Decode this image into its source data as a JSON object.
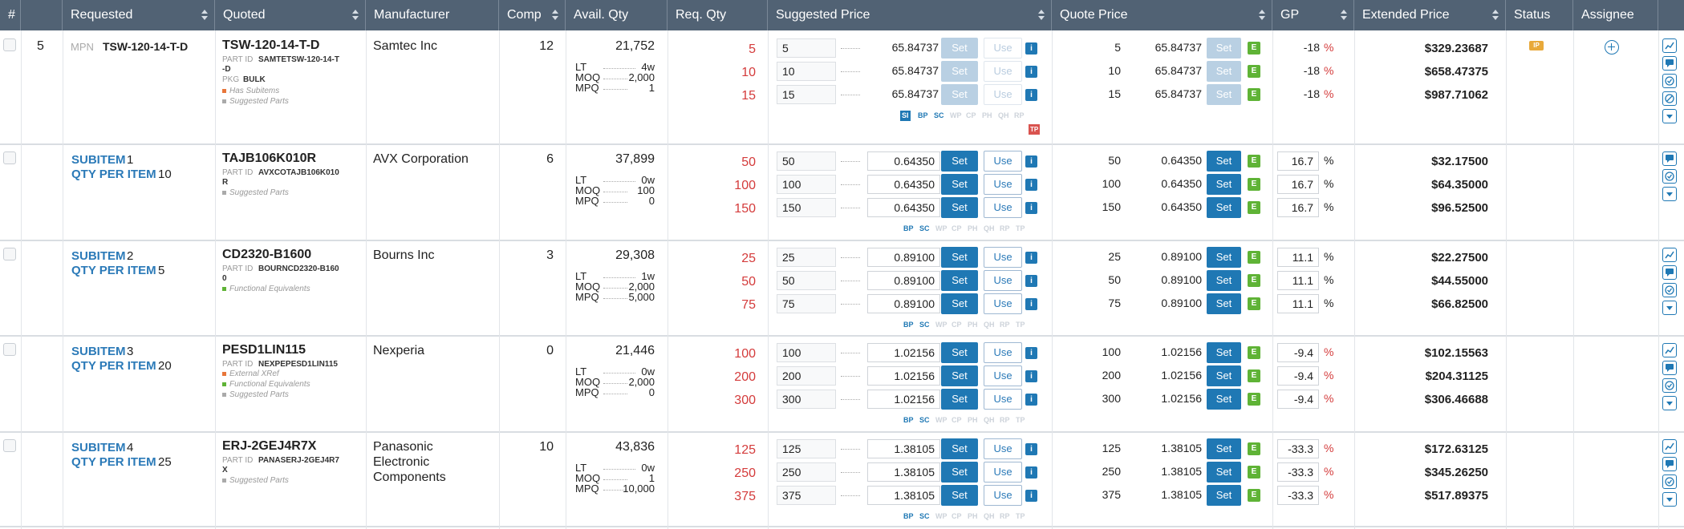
{
  "columns": {
    "num": "#",
    "requested": "Requested",
    "quoted": "Quoted",
    "manufacturer": "Manufacturer",
    "comp": "Comp",
    "avail": "Avail. Qty",
    "req": "Req. Qty",
    "suggested": "Suggested Price",
    "quote": "Quote Price",
    "gp": "GP",
    "extended": "Extended Price",
    "status": "Status",
    "assignee": "Assignee"
  },
  "labels": {
    "mpn": "MPN",
    "part_id": "PART ID",
    "pkg": "PKG",
    "subitem": "SUBITEM",
    "qty_per_item": "QTY PER ITEM",
    "lt": "LT",
    "moq": "MOQ",
    "mpq": "MPQ",
    "set": "Set",
    "use": "Use",
    "info": "i",
    "edit": "E",
    "pct": "%",
    "status_badge": "IP"
  },
  "tags": {
    "si": "SI",
    "bp": "BP",
    "sc": "SC",
    "wp": "WP",
    "cp": "CP",
    "ph": "PH",
    "qh": "QH",
    "rp": "RP",
    "tp": "TP"
  },
  "colors": {
    "header": "#516274",
    "accent": "#1f78b4",
    "edit": "#5fb336",
    "badge": "#e8a93a",
    "alert": "#d43b3b"
  },
  "rows": [
    {
      "row_num": "5",
      "mpn": "TSW-120-14-T-D",
      "quoted": "TSW-120-14-T-D",
      "part_id_l1": "SAMTETSW-120-14-T",
      "part_id_l2": "-D",
      "pkg": "BULK",
      "notes": [
        "Has Subitems",
        "Suggested Parts"
      ],
      "manufacturer": [
        "Samtec Inc"
      ],
      "comp": "12",
      "avail": "21,752",
      "lt": "4w",
      "moq": "2,000",
      "mpq": "1",
      "qtys": [
        "5",
        "10",
        "15"
      ],
      "prices": [
        "65.84737",
        "65.84737",
        "65.84737"
      ],
      "gp": [
        "-18",
        "-18",
        "-18"
      ],
      "ext": [
        "$329.23687",
        "$658.47375",
        "$987.71062"
      ]
    },
    {
      "subitem": "1",
      "qty_per_item": "10",
      "quoted": "TAJB106K010R",
      "part_id_l1": "AVXCOTAJB106K010",
      "part_id_l2": "R",
      "notes": [
        "Suggested Parts"
      ],
      "manufacturer": [
        "AVX Corporation"
      ],
      "comp": "6",
      "avail": "37,899",
      "lt": "0w",
      "moq": "100",
      "mpq": "0",
      "qtys": [
        "50",
        "100",
        "150"
      ],
      "prices": [
        "0.64350",
        "0.64350",
        "0.64350"
      ],
      "gp": [
        "16.7",
        "16.7",
        "16.7"
      ],
      "ext": [
        "$32.17500",
        "$64.35000",
        "$96.52500"
      ]
    },
    {
      "subitem": "2",
      "qty_per_item": "5",
      "quoted": "CD2320-B1600",
      "part_id_l1": "BOURNCD2320-B160",
      "part_id_l2": "0",
      "notes": [
        "Functional Equivalents"
      ],
      "manufacturer": [
        "Bourns Inc"
      ],
      "comp": "3",
      "avail": "29,308",
      "lt": "1w",
      "moq": "2,000",
      "mpq": "5,000",
      "qtys": [
        "25",
        "50",
        "75"
      ],
      "prices": [
        "0.89100",
        "0.89100",
        "0.89100"
      ],
      "gp": [
        "11.1",
        "11.1",
        "11.1"
      ],
      "ext": [
        "$22.27500",
        "$44.55000",
        "$66.82500"
      ]
    },
    {
      "subitem": "3",
      "qty_per_item": "20",
      "quoted": "PESD1LIN115",
      "part_id_l1": "NEXPEPESD1LIN115",
      "part_id_l2": "",
      "notes": [
        "External XRef",
        "Functional Equivalents",
        "Suggested Parts"
      ],
      "manufacturer": [
        "Nexperia"
      ],
      "comp": "0",
      "avail": "21,446",
      "lt": "0w",
      "moq": "2,000",
      "mpq": "0",
      "qtys": [
        "100",
        "200",
        "300"
      ],
      "prices": [
        "1.02156",
        "1.02156",
        "1.02156"
      ],
      "gp": [
        "-9.4",
        "-9.4",
        "-9.4"
      ],
      "ext": [
        "$102.15563",
        "$204.31125",
        "$306.46688"
      ]
    },
    {
      "subitem": "4",
      "qty_per_item": "25",
      "quoted": "ERJ-2GEJ4R7X",
      "part_id_l1": "PANASERJ-2GEJ4R7",
      "part_id_l2": "X",
      "notes": [
        "Suggested Parts"
      ],
      "manufacturer": [
        "Panasonic",
        "Electronic",
        "Components"
      ],
      "comp": "10",
      "avail": "43,836",
      "lt": "0w",
      "moq": "1",
      "mpq": "10,000",
      "qtys": [
        "125",
        "250",
        "375"
      ],
      "prices": [
        "1.38105",
        "1.38105",
        "1.38105"
      ],
      "gp": [
        "-33.3",
        "-33.3",
        "-33.3"
      ],
      "ext": [
        "$172.63125",
        "$345.26250",
        "$517.89375"
      ]
    }
  ]
}
